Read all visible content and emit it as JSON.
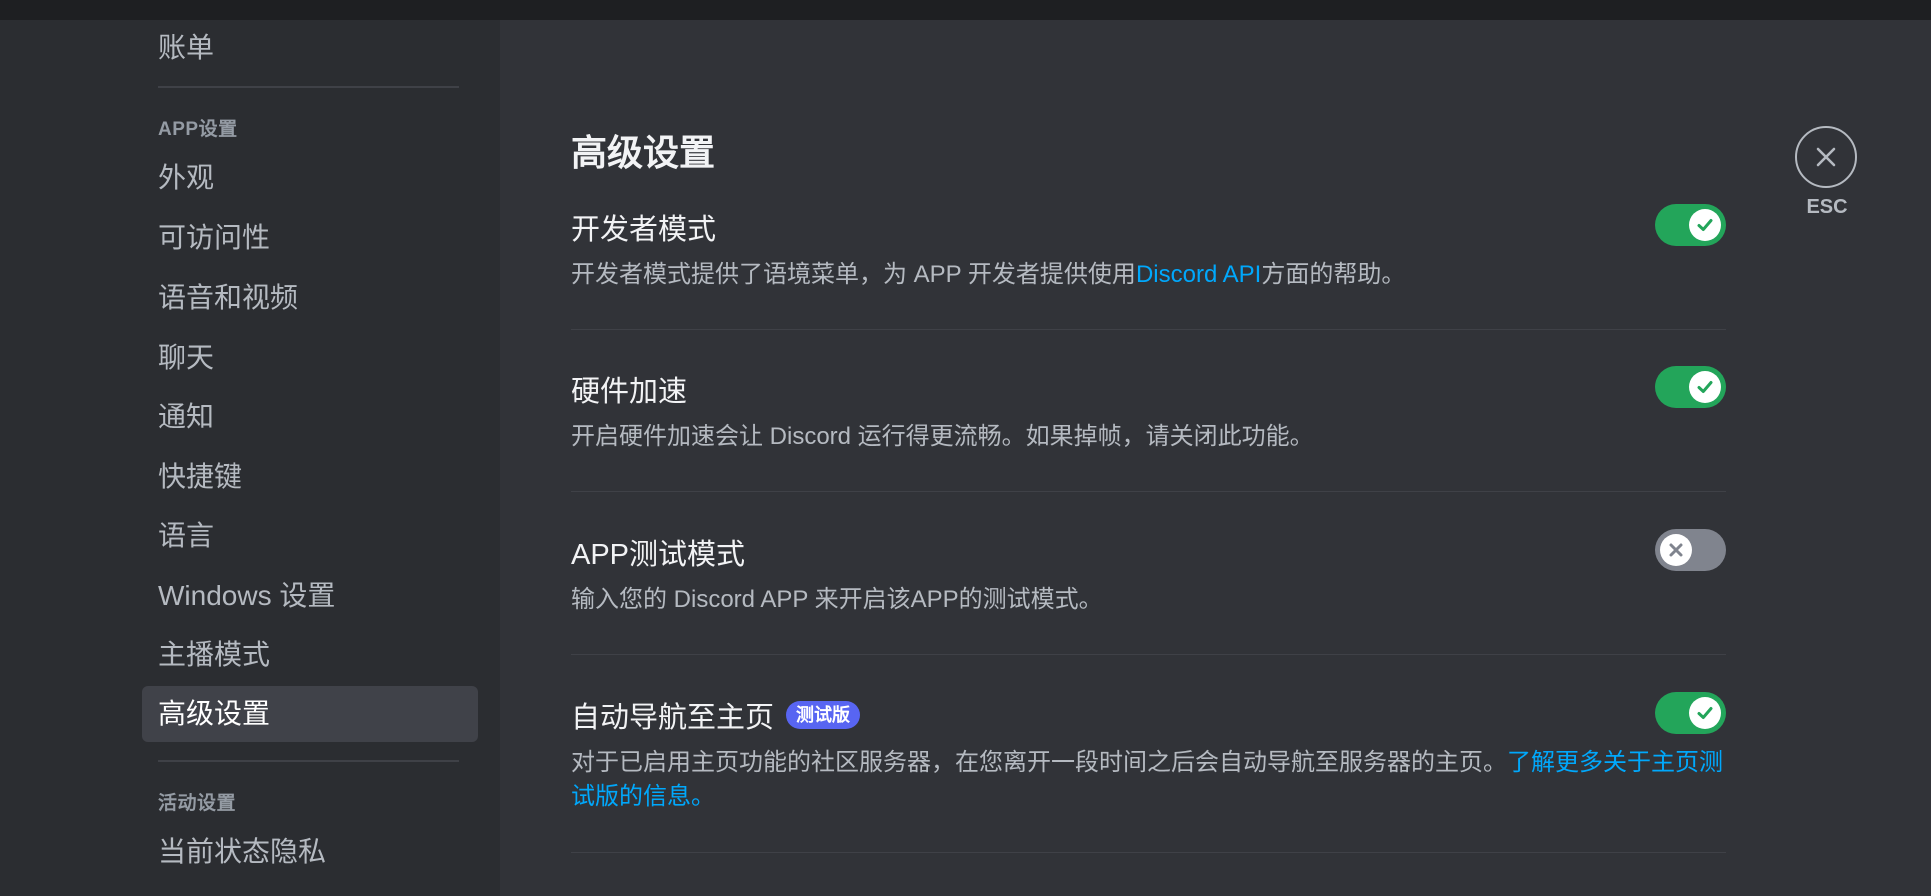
{
  "sidebar": {
    "items_top": [
      {
        "label": "账单"
      }
    ],
    "app_header": "APP设置",
    "app_items": [
      {
        "label": "外观"
      },
      {
        "label": "可访问性"
      },
      {
        "label": "语音和视频"
      },
      {
        "label": "聊天"
      },
      {
        "label": "通知"
      },
      {
        "label": "快捷键"
      },
      {
        "label": "语言"
      },
      {
        "label": "Windows 设置"
      },
      {
        "label": "主播模式"
      },
      {
        "label": "高级设置"
      }
    ],
    "activity_header": "活动设置",
    "activity_items": [
      {
        "label": "当前状态隐私"
      }
    ]
  },
  "main": {
    "title": "高级设置",
    "settings": [
      {
        "title": "开发者模式",
        "desc_pre": "开发者模式提供了语境菜单，为 APP 开发者提供使用",
        "desc_link": "Discord API",
        "desc_post": "方面的帮助。",
        "enabled": true
      },
      {
        "title": "硬件加速",
        "desc": "开启硬件加速会让 Discord 运行得更流畅。如果掉帧，请关闭此功能。",
        "enabled": true
      },
      {
        "title": "APP测试模式",
        "desc": "输入您的 Discord APP 来开启该APP的测试模式。",
        "enabled": false
      },
      {
        "title": "自动导航至主页",
        "badge": "测试版",
        "desc_pre": "对于已启用主页功能的社区服务器，在您离开一段时间之后会自动导航至服务器的主页。",
        "desc_link": "了解更多关于主页测试版的信息。",
        "enabled": true
      }
    ]
  },
  "esc": {
    "label": "ESC",
    "icon": "close-icon"
  },
  "colors": {
    "toggle_on": "#23a55a",
    "toggle_off": "#80848e",
    "link": "#00a8fc",
    "badge": "#5865f2"
  }
}
